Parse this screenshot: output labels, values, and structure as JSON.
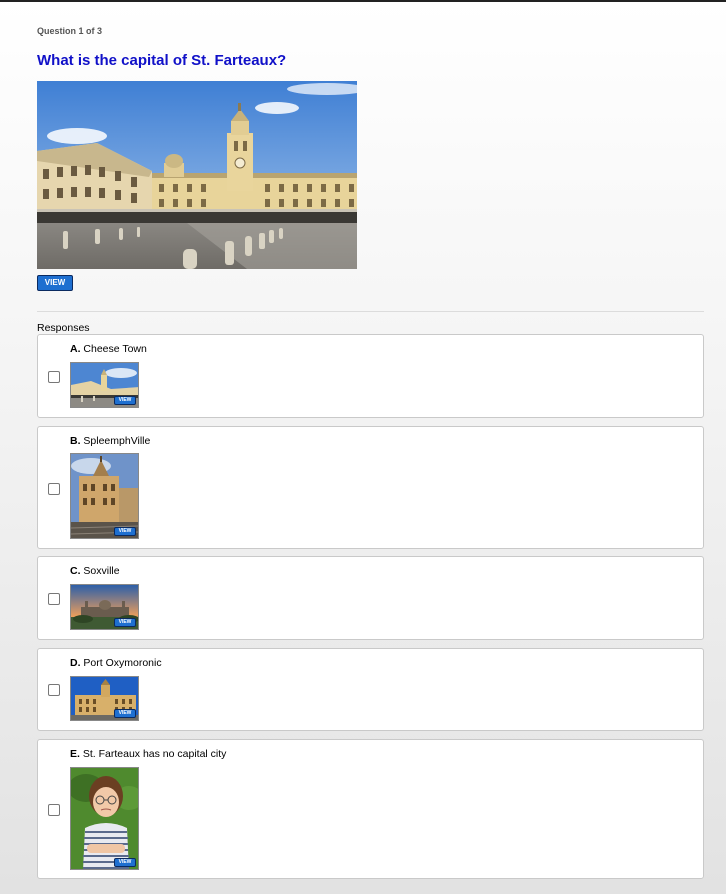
{
  "header": {
    "question_count": "Question 1 of 3",
    "question_title": "What is the capital of St. Farteaux?",
    "view_label": "VIEW"
  },
  "responses": {
    "label": "Responses",
    "options": [
      {
        "letter": "A.",
        "text": "Cheese Town",
        "view_label": "VIEW",
        "checked": false
      },
      {
        "letter": "B.",
        "text": "SpleemphVille",
        "view_label": "VIEW",
        "checked": false
      },
      {
        "letter": "C.",
        "text": "Soxville",
        "view_label": "VIEW",
        "checked": false
      },
      {
        "letter": "D.",
        "text": "Port Oxymoronic",
        "view_label": "VIEW",
        "checked": false
      },
      {
        "letter": "E.",
        "text": "St. Farteaux has no capital city",
        "view_label": "VIEW",
        "checked": false
      }
    ]
  },
  "colors": {
    "title": "#1010c8",
    "button": "#1e6fd0"
  }
}
